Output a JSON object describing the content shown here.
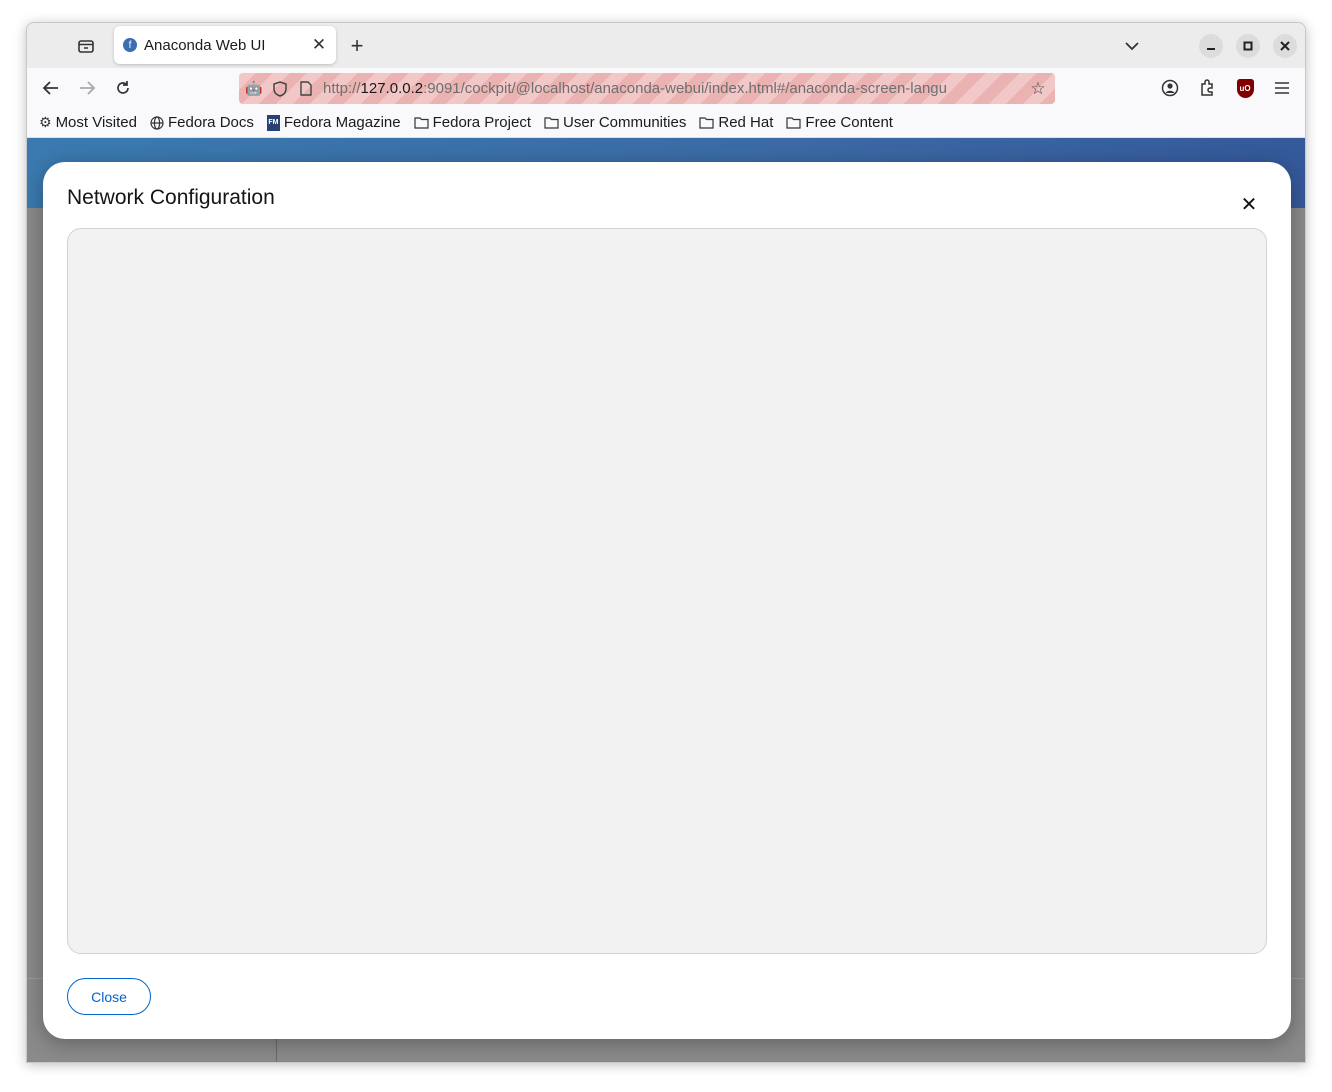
{
  "browser": {
    "tab": {
      "title": "Anaconda Web UI"
    },
    "url": {
      "scheme": "http://",
      "host": "127.0.0.2",
      "rest": ":9091/cockpit/@localhost/anaconda-webui/index.html#/anaconda-screen-langu"
    },
    "bookmarks": [
      {
        "label": "Most Visited",
        "icon": "gear-icon"
      },
      {
        "label": "Fedora Docs",
        "icon": "globe-icon"
      },
      {
        "label": "Fedora Magazine",
        "icon": "fedora-magazine-icon"
      },
      {
        "label": "Fedora Project",
        "icon": "folder-icon"
      },
      {
        "label": "User Communities",
        "icon": "folder-icon"
      },
      {
        "label": "Red Hat",
        "icon": "folder-icon"
      },
      {
        "label": "Free Content",
        "icon": "folder-icon"
      }
    ]
  },
  "modal": {
    "title": "Network Configuration",
    "close_label": "Close"
  },
  "colors": {
    "header_blue": "#3b6aa5",
    "link_blue": "#0066cc",
    "url_warning": "#f2c7c7"
  }
}
